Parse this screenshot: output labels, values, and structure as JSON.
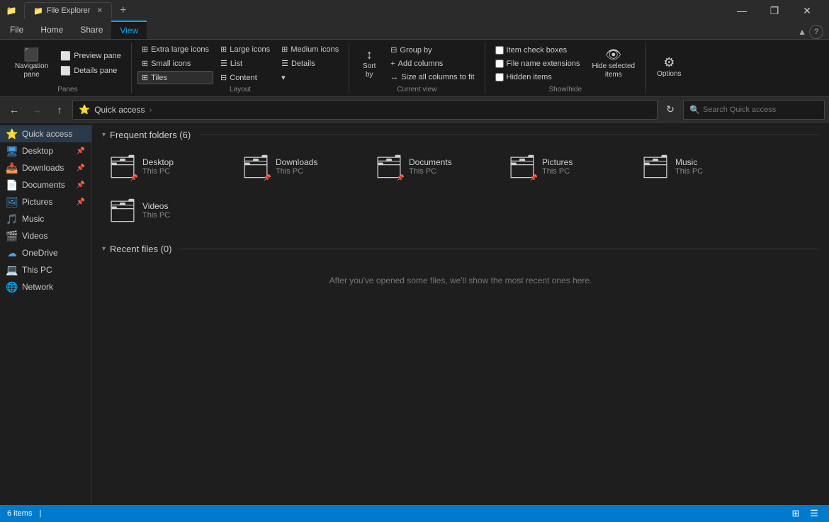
{
  "titlebar": {
    "icon": "📁",
    "title": "File Explorer",
    "tab_label": "File Explorer",
    "minimize": "—",
    "restore": "❐",
    "close": "✕",
    "new_tab": "+"
  },
  "ribbon_tabs": {
    "items": [
      "File",
      "Home",
      "Share",
      "View"
    ],
    "active": "View",
    "help_label": "?"
  },
  "ribbon": {
    "groups": {
      "panes": {
        "label": "Panes",
        "nav_pane": "Navigation\npane",
        "preview_pane": "Preview pane",
        "details_pane": "Details pane"
      },
      "layout": {
        "label": "Layout",
        "extra_large": "Extra large icons",
        "large": "Large icons",
        "medium": "Medium icons",
        "small": "Small icons",
        "list": "List",
        "details": "Details",
        "tiles": "Tiles",
        "content": "Content",
        "dropdown": "▾"
      },
      "current_view": {
        "label": "Current view",
        "sort_by": "Sort\nby",
        "group_by": "Group by",
        "add_columns": "Add columns",
        "size_all": "Size all columns to fit"
      },
      "show_hide": {
        "label": "Show/hide",
        "item_check_boxes": "Item check boxes",
        "file_name_ext": "File name extensions",
        "hidden_items": "Hidden items",
        "hide_selected": "Hide selected\nitems"
      },
      "options": {
        "label": "",
        "options": "Options"
      }
    }
  },
  "navbar": {
    "back_disabled": false,
    "forward_disabled": true,
    "up_disabled": false,
    "path": [
      "Quick access"
    ],
    "refresh_tooltip": "Refresh",
    "search_placeholder": "Search Quick access"
  },
  "sidebar": {
    "quick_access_label": "Quick access",
    "items": [
      {
        "id": "quick-access",
        "label": "Quick access",
        "icon": "⭐",
        "pinned": false,
        "active": true,
        "is_section": true
      },
      {
        "id": "desktop",
        "label": "Desktop",
        "icon": "🖥",
        "pinned": true
      },
      {
        "id": "downloads",
        "label": "Downloads",
        "icon": "📥",
        "pinned": true
      },
      {
        "id": "documents",
        "label": "Documents",
        "icon": "📄",
        "pinned": true
      },
      {
        "id": "pictures",
        "label": "Pictures",
        "icon": "🖼",
        "pinned": true
      },
      {
        "id": "music",
        "label": "Music",
        "icon": "🎵",
        "pinned": false
      },
      {
        "id": "videos",
        "label": "Videos",
        "icon": "🎬",
        "pinned": false
      },
      {
        "id": "onedrive",
        "label": "OneDrive",
        "icon": "☁",
        "pinned": false,
        "is_section": true
      },
      {
        "id": "this-pc",
        "label": "This PC",
        "icon": "💻",
        "pinned": false,
        "is_section": true
      },
      {
        "id": "network",
        "label": "Network",
        "icon": "🌐",
        "pinned": false,
        "is_section": true
      }
    ]
  },
  "content": {
    "frequent_section": "Frequent folders (6)",
    "frequent_count": 6,
    "folders": [
      {
        "id": "desktop",
        "name": "Desktop",
        "sub": "This PC",
        "icon": "🖥",
        "pinned": true
      },
      {
        "id": "downloads",
        "name": "Downloads",
        "sub": "This PC",
        "icon": "📥",
        "pinned": true
      },
      {
        "id": "documents",
        "name": "Documents",
        "sub": "This PC",
        "icon": "📄",
        "pinned": true
      },
      {
        "id": "pictures",
        "name": "Pictures",
        "sub": "This PC",
        "icon": "🖼",
        "pinned": true
      },
      {
        "id": "music",
        "name": "Music",
        "sub": "This PC",
        "icon": "🎵",
        "pinned": false
      },
      {
        "id": "videos",
        "name": "Videos",
        "sub": "This PC",
        "icon": "🎬",
        "pinned": false
      }
    ],
    "recent_section": "Recent files (0)",
    "recent_empty_text": "After you've opened some files, we'll show the most recent ones here."
  },
  "statusbar": {
    "item_count": "6 items",
    "separator": "|"
  },
  "icons": {
    "back": "←",
    "forward": "→",
    "up": "↑",
    "refresh": "↻",
    "search": "🔍",
    "chevron_down": "▾",
    "pin": "📌",
    "collapse": "▾",
    "grid_view": "⊞",
    "list_view": "☰"
  }
}
